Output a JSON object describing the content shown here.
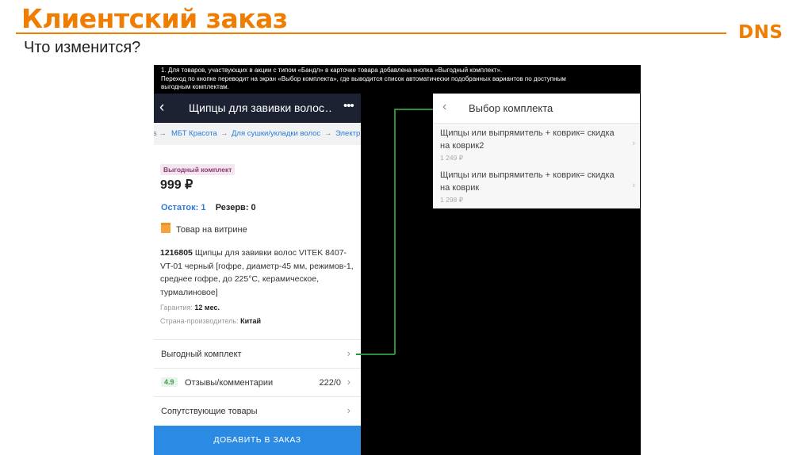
{
  "slide": {
    "title": "Клиентский заказ",
    "subtitle": "Что изменится?",
    "logo": "DNS",
    "note_lines": [
      "1. Для товаров, участвующих в акции с типом «Бандл» в карточке товара добавлена кнопка «Выгодный комплект».",
      "Переход по кнопке переводит на экран «Выбор комплекта», где выводится список автоматически подобранных вариантов по доступным",
      "выгодным комплектам."
    ]
  },
  "product_screen": {
    "header_title": "Щипцы для завивки волос",
    "breadcrumbs": [
      "МБТ Красота",
      "Для сушки/укладки волос",
      "Электр"
    ],
    "badge": "Выгодный комплект",
    "price": "999 ₽",
    "stock_label": "Остаток: 1",
    "reserve_label": "Резерв: 0",
    "showcase": "Товар на витрине",
    "code": "1216805",
    "description": "Щипцы для завивки волос VITEK 8407-VT-01 черный [гофре, диаметр-45 мм, режимов-1, среднее гофре, до 225°C, керамическое, турмалиновое]",
    "warranty_label": "Гарантия:",
    "warranty_value": "12 мес.",
    "country_label": "Страна-производитель:",
    "country_value": "Китай",
    "rows": {
      "bundle": "Выгодный комплект",
      "rating": "4.9",
      "reviews": "Отзывы/комментарии",
      "reviews_count": "222/0",
      "related": "Сопутствующие товары"
    },
    "cta": "ДОБАВИТЬ В ЗАКАЗ"
  },
  "bundle_screen": {
    "header_title": "Выбор комплекта",
    "items": [
      {
        "name": "Щипцы или выпрямитель + коврик= скидка на коврик2",
        "price": "1 249 ₽"
      },
      {
        "name": "Щипцы или выпрямитель + коврик= скидка на коврик",
        "price": "1 298 ₽"
      }
    ]
  },
  "icons": {
    "back": "chevron-left-icon",
    "more": "more-dots-icon",
    "showcase": "storefront-icon",
    "row_chevron": "chevron-right-icon"
  },
  "colors": {
    "accent": "#f07c00",
    "header_dark": "#1d2233",
    "link": "#2b7ad6",
    "cta": "#2b8be4",
    "connector": "#2e8f3a"
  }
}
